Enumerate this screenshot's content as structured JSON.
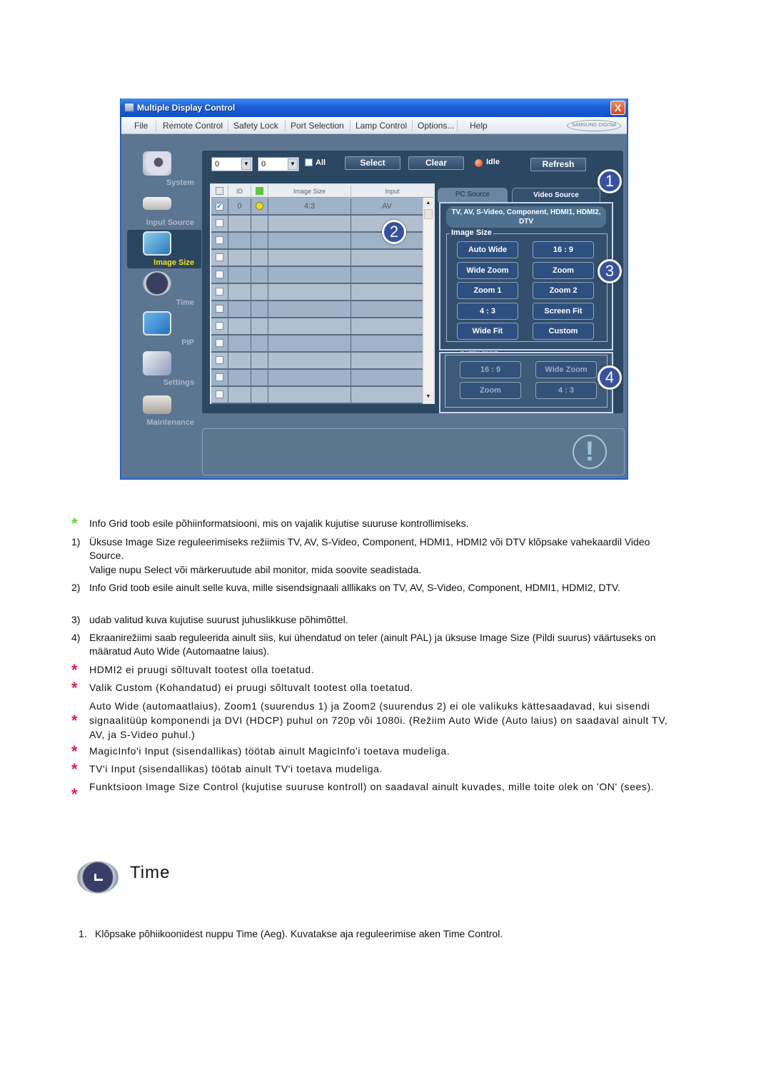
{
  "app": {
    "window_title": "Multiple Display Control",
    "close_label": "X",
    "menu": [
      "File",
      "Remote Control",
      "Safety Lock",
      "Port Selection",
      "Lamp Control",
      "Options...",
      "Help"
    ],
    "brand_logo": "SAMSUNG DIGITall",
    "sidebar": [
      {
        "label": "System",
        "active": false
      },
      {
        "label": "Input Source",
        "active": false
      },
      {
        "label": "Image Size",
        "active": true
      },
      {
        "label": "Time",
        "active": false
      },
      {
        "label": "PIP",
        "active": false
      },
      {
        "label": "Settings",
        "active": false
      },
      {
        "label": "Maintenance",
        "active": false
      }
    ],
    "toolbar": {
      "from_id": "0",
      "to_id": "0",
      "all_label": "All",
      "select_label": "Select",
      "clear_label": "Clear",
      "status_label": "Idle",
      "refresh_label": "Refresh"
    },
    "grid": {
      "headers": [
        "",
        "ID",
        "",
        "Image Size",
        "Input"
      ],
      "rows": [
        {
          "checked": true,
          "id": "0",
          "power": true,
          "image_size": "4:3",
          "input": "AV"
        },
        {
          "checked": false,
          "id": "",
          "power": false,
          "image_size": "",
          "input": ""
        },
        {
          "checked": false,
          "id": "",
          "power": false,
          "image_size": "",
          "input": ""
        },
        {
          "checked": false,
          "id": "",
          "power": false,
          "image_size": "",
          "input": ""
        },
        {
          "checked": false,
          "id": "",
          "power": false,
          "image_size": "",
          "input": ""
        },
        {
          "checked": false,
          "id": "",
          "power": false,
          "image_size": "",
          "input": ""
        },
        {
          "checked": false,
          "id": "",
          "power": false,
          "image_size": "",
          "input": ""
        },
        {
          "checked": false,
          "id": "",
          "power": false,
          "image_size": "",
          "input": ""
        },
        {
          "checked": false,
          "id": "",
          "power": false,
          "image_size": "",
          "input": ""
        },
        {
          "checked": false,
          "id": "",
          "power": false,
          "image_size": "",
          "input": ""
        },
        {
          "checked": false,
          "id": "",
          "power": false,
          "image_size": "",
          "input": ""
        },
        {
          "checked": false,
          "id": "",
          "power": false,
          "image_size": "",
          "input": ""
        }
      ]
    },
    "tabs": {
      "pc_source": "PC Source",
      "video_source": "Video Source"
    },
    "source_banner": "TV, AV, S-Video, Component, HDMI1, HDMI2, DTV",
    "image_size": {
      "legend": "Image Size",
      "buttons": [
        "Auto Wide",
        "16 : 9",
        "Wide Zoom",
        "Zoom",
        "Zoom 1",
        "Zoom 2",
        "4 : 3",
        "Screen Fit",
        "Wide Fit",
        "Custom"
      ]
    },
    "screen_mode": {
      "legend": "Screen Mode",
      "buttons": [
        "16 : 9",
        "Wide Zoom",
        "Zoom",
        "4 : 3"
      ]
    },
    "badges": [
      "1",
      "2",
      "3",
      "4"
    ],
    "colors": {
      "title_bar": "#1b5fd8",
      "panel": "#2b4762",
      "frame": "#5c7590",
      "active_label": "#f2e21c",
      "close": "#d9481e"
    }
  },
  "doc": {
    "intro": "Info Grid toob esile põhiinformatsiooni, mis on vajalik kujutise suuruse kontrollimiseks.",
    "steps": [
      {
        "num": "1)",
        "lines": [
          "Üksuse Image Size reguleerimiseks režiimis TV, AV, S-Video, Component, HDMI1, HDMI2 või DTV klõpsake vahekaardil Video Source.",
          "Valige nupu Select või märkeruutude abil monitor, mida soovite seadistada."
        ]
      },
      {
        "num": "2)",
        "lines": [
          "Info Grid toob esile ainult selle kuva, mille sisendsignaali alllikaks on TV, AV, S-Video, Component, HDMI1, HDMI2, DTV."
        ]
      },
      {
        "num": "3)",
        "lines": [
          "udab valitud kuva kujutise suurust juhuslikkuse põhimõttel."
        ]
      },
      {
        "num": "4)",
        "lines": [
          "Ekraanirežiimi saab reguleerida ainult siis, kui ühendatud on teler (ainult PAL) ja üksuse Image Size (Pildi suurus) väärtuseks on määratud Auto Wide (Automaatne laius)."
        ]
      }
    ],
    "notes": [
      "HDMI2 ei pruugi sõltuvalt tootest olla toetatud.",
      "Valik Custom (Kohandatud) ei pruugi sõltuvalt tootest olla toetatud.",
      "Auto Wide (automaatlaius), Zoom1 (suurendus 1) ja Zoom2 (suurendus 2) ei ole valikuks kättesaadavad, kui sisendi signaalitüüp komponendi ja DVI (HDCP) puhul on 720p või 1080i. (Režiim Auto Wide (Auto laius) on saadaval ainult TV, AV, ja S-Video puhul.)",
      "MagicInfo'i Input (sisendallikas) töötab ainult MagicInfo'i toetava mudeliga.",
      "TV'i Input (sisendallikas) töötab ainult TV'i toetava mudeliga.",
      "Funktsioon Image Size Control (kujutise suuruse kontroll) on saadaval ainult kuvades, mille toite olek on 'ON' (sees)."
    ],
    "section_title": "Time",
    "section_steps": [
      {
        "num": "1.",
        "text": "Klõpsake põhiikoonidest nuppu Time (Aeg). Kuvatakse aja reguleerimise aken Time Control."
      }
    ],
    "star_colors": {
      "intro": "#6fd23a",
      "notes": "#e8184a"
    }
  }
}
